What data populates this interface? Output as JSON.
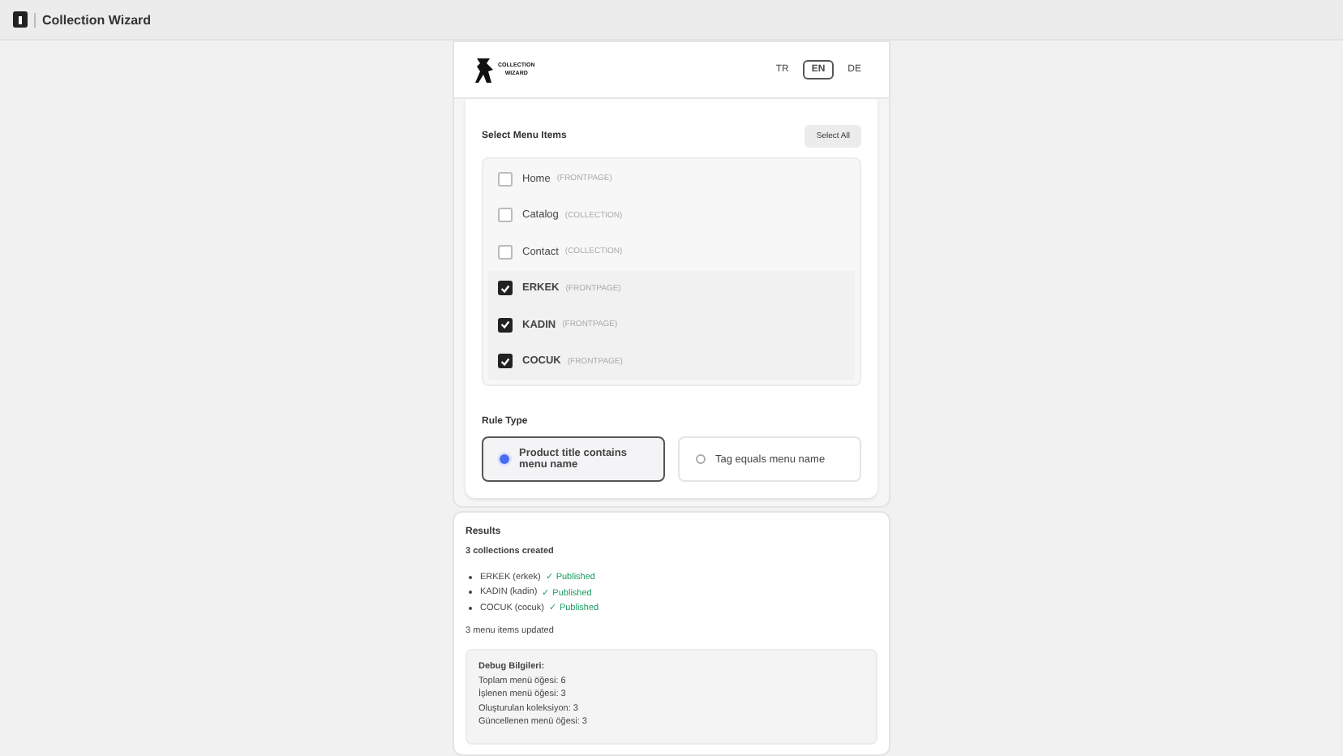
{
  "app_bar": {
    "title": "Collection Wizard"
  },
  "logo": {
    "line_1": "COLLECTION",
    "line_2": "WIZARD"
  },
  "languages": [
    {
      "label": "TR",
      "selected": false
    },
    {
      "label": "EN",
      "selected": true
    },
    {
      "label": "DE",
      "selected": false
    }
  ],
  "menu_items": {
    "title": "Select Menu Items",
    "select_all": "Select All",
    "items": [
      {
        "name": "Home",
        "type": "(FRONTPAGE)",
        "checked": false
      },
      {
        "name": "Catalog",
        "type": "(COLLECTION)",
        "checked": false
      },
      {
        "name": "Contact",
        "type": "(COLLECTION)",
        "checked": false
      },
      {
        "name": "ERKEK",
        "type": "(FRONTPAGE)",
        "checked": true
      },
      {
        "name": "KADIN",
        "type": "(FRONTPAGE)",
        "checked": true
      },
      {
        "name": "COCUK",
        "type": "(FRONTPAGE)",
        "checked": true
      }
    ]
  },
  "rule_type": {
    "title": "Rule Type",
    "options": [
      {
        "label": "Product title contains menu name",
        "selected": true
      },
      {
        "label": "Tag equals menu name",
        "selected": false
      }
    ]
  },
  "results": {
    "title": "Results",
    "summary": "3 collections created",
    "collections": [
      {
        "name": "ERKEK (erkek)",
        "status": "✓ Published"
      },
      {
        "name": "KADIN (kadin)",
        "status": "✓ Published"
      },
      {
        "name": "COCUK (cocuk)",
        "status": "✓ Published"
      }
    ],
    "updated": "3 menu items updated",
    "debug": {
      "title": "Debug Bilgileri:",
      "lines": [
        "Toplam menü öğesi: 6",
        "İşlenen menü öğesi: 3",
        "Oluşturulan koleksiyon: 3",
        "Güncellenen menü öğesi: 3"
      ]
    }
  }
}
